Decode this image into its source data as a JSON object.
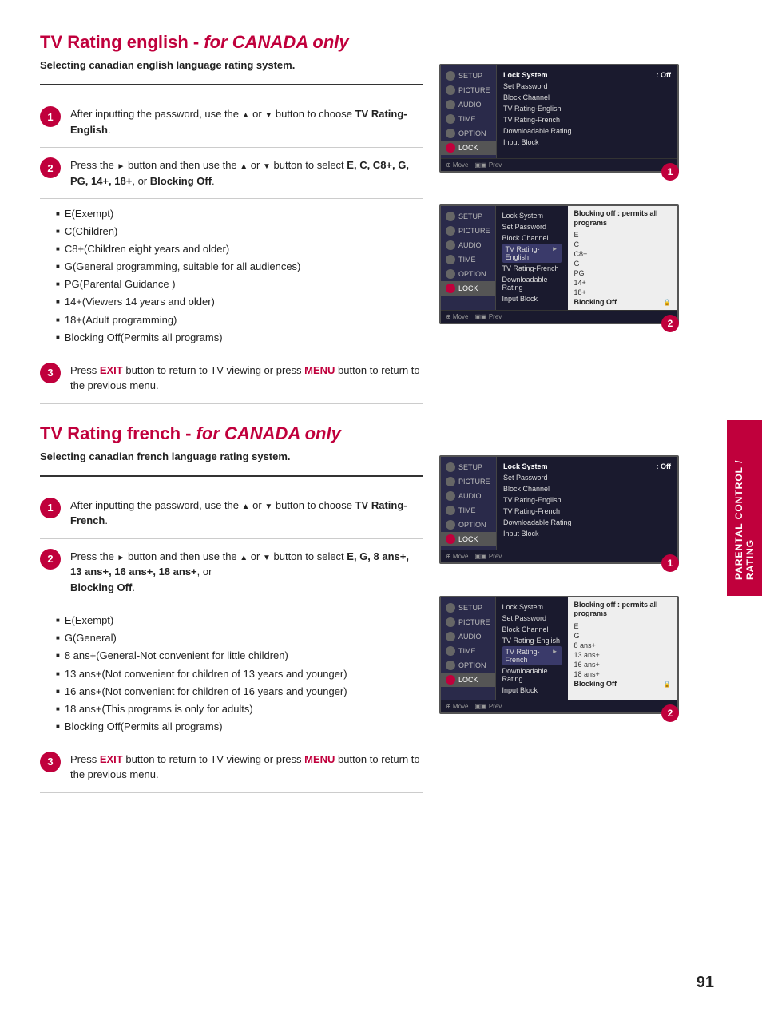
{
  "english_section": {
    "title": "TV Rating english - ",
    "title_italic": "for CANADA only",
    "subtitle": "Selecting canadian english language rating system.",
    "steps": [
      {
        "number": "1",
        "text_before": "After inputting the password, use the ",
        "arrows": "▲ or ▼",
        "text_after": " button to choose ",
        "bold_word": "TV Rating-English",
        "trailing": "."
      },
      {
        "number": "2",
        "text_before": "Press the ► button and then use the ▲ or ▼ button to select ",
        "bold_word": "E, C, C8+, G, PG, 14+, 18+",
        "text_after": ", or ",
        "bold_word2": "Blocking Off",
        "trailing": "."
      },
      {
        "number": "3",
        "text_before": "Press ",
        "exit": "EXIT",
        "text_mid": " button to return to TV viewing or press ",
        "menu": "MENU",
        "text_after": " button to return to the previous menu."
      }
    ],
    "bullets": [
      "E(Exempt)",
      "C(Children)",
      "C8+(Children eight years and older)",
      "G(General programming, suitable for all audiences)",
      "PG(Parental Guidance )",
      "14+(Viewers 14 years and older)",
      "18+(Adult programming)",
      "Blocking Off(Permits all programs)"
    ]
  },
  "french_section": {
    "title": "TV Rating french - ",
    "title_italic": "for CANADA only",
    "subtitle": "Selecting canadian french language rating system.",
    "steps": [
      {
        "number": "1",
        "text_before": "After inputting the password, use the ▲ or ▼ button to choose ",
        "bold_word": "TV Rating-French",
        "trailing": "."
      },
      {
        "number": "2",
        "text_before": "Press the ► button and then use the ▲ or ▼ button to select ",
        "bold_word": "E, G, 8 ans+, 13 ans+, 16 ans+, 18 ans+",
        "text_after": ", or",
        "newline_bold": "Blocking Off",
        "trailing": "."
      },
      {
        "number": "3",
        "text_before": "Press ",
        "exit": "EXIT",
        "text_mid": " button to return to TV viewing or press ",
        "menu": "MENU",
        "text_after": " button to return to the previous menu."
      }
    ],
    "bullets": [
      "E(Exempt)",
      "G(General)",
      "8 ans+(General-Not convenient for little children)",
      "13 ans+(Not convenient for children of 13 years and younger)",
      "16 ans+(Not convenient for children of 16 years and younger)",
      "18 ans+(This programs is only for adults)",
      "Blocking Off(Permits all programs)"
    ]
  },
  "sidebar_label": "PARENTAL CONTROL / RATING",
  "page_number": "91",
  "screens": {
    "english_screen1": {
      "menu_items": [
        {
          "label": "Lock System",
          "value": ": Off"
        },
        {
          "label": "Set Password",
          "value": ""
        },
        {
          "label": "Block Channel",
          "value": ""
        },
        {
          "label": "TV Rating-English",
          "value": ""
        },
        {
          "label": "TV Rating-French",
          "value": ""
        },
        {
          "label": "Downloadable Rating",
          "value": ""
        },
        {
          "label": "Input Block",
          "value": ""
        }
      ],
      "sidebar": [
        "SETUP",
        "PICTURE",
        "AUDIO",
        "TIME",
        "OPTION",
        "LOCK"
      ]
    },
    "english_screen2": {
      "menu_items": [
        {
          "label": "Lock System",
          "value": ""
        },
        {
          "label": "Set Password",
          "value": ""
        },
        {
          "label": "Block Channel",
          "value": ""
        },
        {
          "label": "TV Rating-English",
          "value": "►"
        },
        {
          "label": "TV Rating-French",
          "value": ""
        },
        {
          "label": "Downloadable Rating",
          "value": ""
        },
        {
          "label": "Input Block",
          "value": ""
        }
      ],
      "sidebar": [
        "SETUP",
        "PICTURE",
        "AUDIO",
        "TIME",
        "OPTION",
        "LOCK"
      ],
      "submenu_title": "Blocking off : permits all programs",
      "submenu_items": [
        "E",
        "C",
        "C8+",
        "G",
        "PG",
        "14+",
        "18+",
        "Blocking Off"
      ]
    },
    "french_screen1": {
      "menu_items": [
        {
          "label": "Lock System",
          "value": ": Off"
        },
        {
          "label": "Set Password",
          "value": ""
        },
        {
          "label": "Block Channel",
          "value": ""
        },
        {
          "label": "TV Rating-English",
          "value": ""
        },
        {
          "label": "TV Rating-French",
          "value": ""
        },
        {
          "label": "Downloadable Rating",
          "value": ""
        },
        {
          "label": "Input Block",
          "value": ""
        }
      ],
      "sidebar": [
        "SETUP",
        "PICTURE",
        "AUDIO",
        "TIME",
        "OPTION",
        "LOCK"
      ]
    },
    "french_screen2": {
      "menu_items": [
        {
          "label": "Lock System",
          "value": ""
        },
        {
          "label": "Set Password",
          "value": ""
        },
        {
          "label": "Block Channel",
          "value": ""
        },
        {
          "label": "TV Rating-English",
          "value": ""
        },
        {
          "label": "TV Rating-French",
          "value": "►"
        },
        {
          "label": "Downloadable Rating",
          "value": ""
        },
        {
          "label": "Input Block",
          "value": ""
        }
      ],
      "sidebar": [
        "SETUP",
        "PICTURE",
        "AUDIO",
        "TIME",
        "OPTION",
        "LOCK"
      ],
      "submenu_title": "Blocking off : permits all programs",
      "submenu_items": [
        "E",
        "G",
        "8 ans+",
        "13 ans+",
        "16 ans+",
        "18 ans+",
        "Blocking Off"
      ]
    }
  }
}
